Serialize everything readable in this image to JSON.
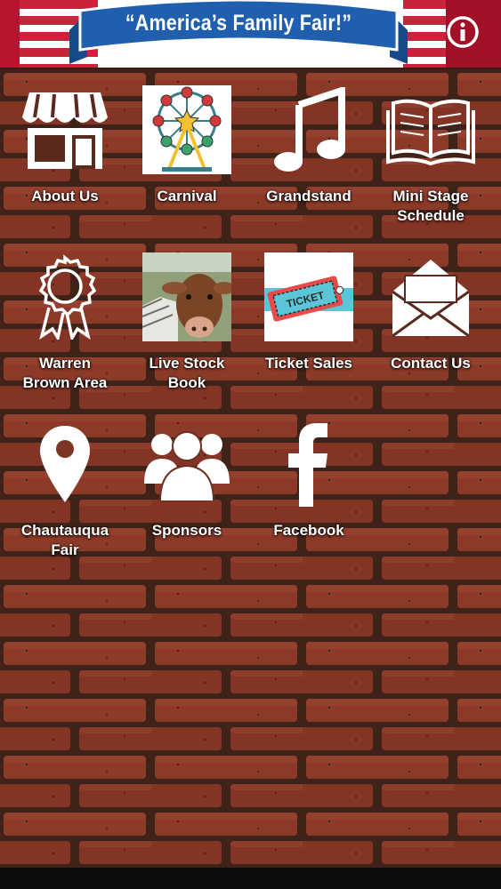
{
  "header": {
    "slogan": "“America’s Family Fair!”",
    "info_icon": "info-icon"
  },
  "tiles": [
    {
      "label": "About Us",
      "icon": "storefront-icon"
    },
    {
      "label": "Carnival",
      "icon": "ferris-wheel-image"
    },
    {
      "label": "Grandstand",
      "icon": "music-note-icon"
    },
    {
      "label": "Mini Stage\nSchedule",
      "icon": "open-book-icon"
    },
    {
      "label": "Warren\nBrown Area",
      "icon": "award-ribbon-icon"
    },
    {
      "label": "Live Stock\nBook",
      "icon": "cow-photo"
    },
    {
      "label": "Ticket Sales",
      "icon": "ticket-image"
    },
    {
      "label": "Contact Us",
      "icon": "envelope-icon"
    },
    {
      "label": "Chautauqua\nFair",
      "icon": "map-pin-icon"
    },
    {
      "label": "Sponsors",
      "icon": "people-group-icon"
    },
    {
      "label": "Facebook",
      "icon": "facebook-icon"
    }
  ],
  "colors": {
    "brick": "#8c3a28",
    "mortar": "#3f2218",
    "banner_blue": "#1f5fae",
    "banner_red": "#c8233a"
  },
  "ticket_text": "TICKET"
}
